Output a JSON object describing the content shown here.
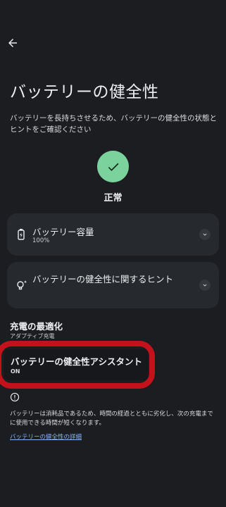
{
  "header": {
    "back_icon": "arrow-back-icon"
  },
  "page": {
    "title": "バッテリーの健全性",
    "description": "バッテリーを長持ちさせるため、バッテリーの健全性の状態とヒントをご確認ください"
  },
  "status": {
    "icon": "check-icon",
    "label": "正常",
    "color": "#7cd29c"
  },
  "cards": [
    {
      "icon": "battery-charging-icon",
      "title": "バッテリー容量",
      "subtitle": "100%",
      "chevron": "chevron-down-icon"
    },
    {
      "icon": "lightbulb-sparkle-icon",
      "title": "バッテリーの健全性に関するヒント",
      "chevron": "chevron-down-icon"
    }
  ],
  "charging": {
    "title": "充電の最適化",
    "subtitle": "アダプティブ充電"
  },
  "assistant": {
    "title": "バッテリーの健全性アシスタント",
    "value": "ON",
    "highlight_color": "#c4121c"
  },
  "footer": {
    "info_icon": "info-icon",
    "text": "バッテリーは消耗品であるため、時間の経過とともに劣化し、次の充電までに使用できる時間が短くなります。",
    "link": "バッテリーの健全性の詳細"
  },
  "colors": {
    "background": "#1b1d21",
    "card": "#26292d",
    "link": "#8ab4f8"
  }
}
